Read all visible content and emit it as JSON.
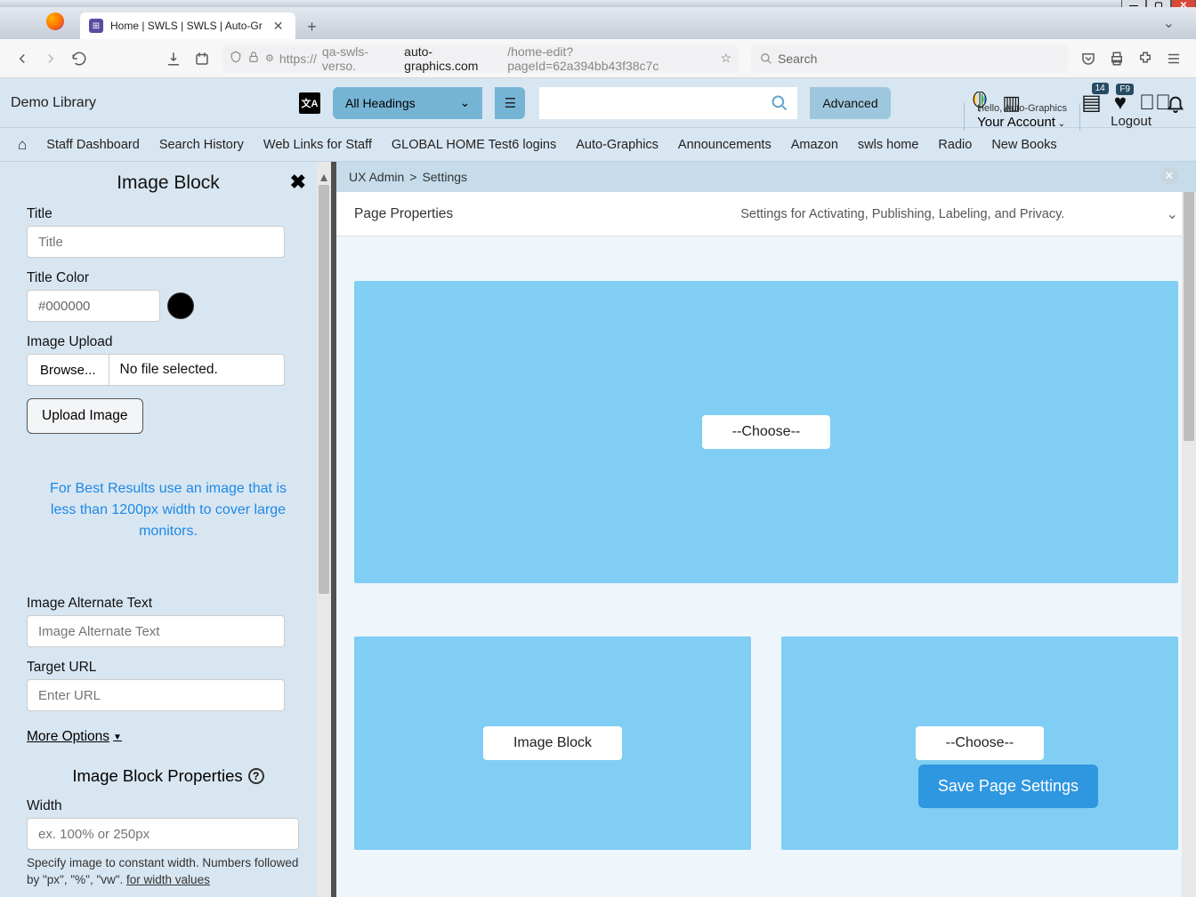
{
  "window": {
    "title": "Home | SWLS | SWLS | Auto-Gr"
  },
  "browser": {
    "url_proto": "https://",
    "url_host_pre": "qa-swls-verso.",
    "url_host_main": "auto-graphics.com",
    "url_path": "/home-edit?pageId=62a394bb43f38c7c",
    "search_placeholder": "Search"
  },
  "header": {
    "app_title": "Demo Library",
    "headings_label": "All Headings",
    "advanced_label": "Advanced",
    "hello_text": "Hello, Auto-Graphics",
    "account_label": "Your Account",
    "logout_label": "Logout",
    "badge_14": "14",
    "badge_f9": "F9"
  },
  "nav": {
    "items": [
      "Staff Dashboard",
      "Search History",
      "Web Links for Staff",
      "GLOBAL HOME Test6 logins",
      "Auto-Graphics",
      "Announcements",
      "Amazon",
      "swls home",
      "Radio",
      "New Books"
    ]
  },
  "sidebar": {
    "panel_title": "Image Block",
    "title_label": "Title",
    "title_placeholder": "Title",
    "title_color_label": "Title Color",
    "title_color_value": "#000000",
    "image_upload_label": "Image Upload",
    "browse_label": "Browse...",
    "no_file_label": "No file selected.",
    "upload_btn_label": "Upload Image",
    "hint_text": "For Best Results use an image that is less than 1200px width to cover large monitors.",
    "alt_label": "Image Alternate Text",
    "alt_placeholder": "Image Alternate Text",
    "target_label": "Target URL",
    "target_placeholder": "Enter URL",
    "more_options_label": "More Options",
    "props_title": "Image Block Properties",
    "width_label": "Width",
    "width_placeholder": "ex. 100% or 250px",
    "width_hint_1": "Specify image to constant width. Numbers followed by \"px\", \"%\", \"vw\". ",
    "width_hint_link": "for width values"
  },
  "canvas": {
    "bc_1": "UX Admin",
    "bc_sep": ">",
    "bc_2": "Settings",
    "props_title": "Page Properties",
    "props_desc": "Settings for Activating, Publishing, Labeling, and Privacy.",
    "choose_label": "--Choose--",
    "image_block_label": "Image Block",
    "save_label": "Save Page Settings"
  }
}
